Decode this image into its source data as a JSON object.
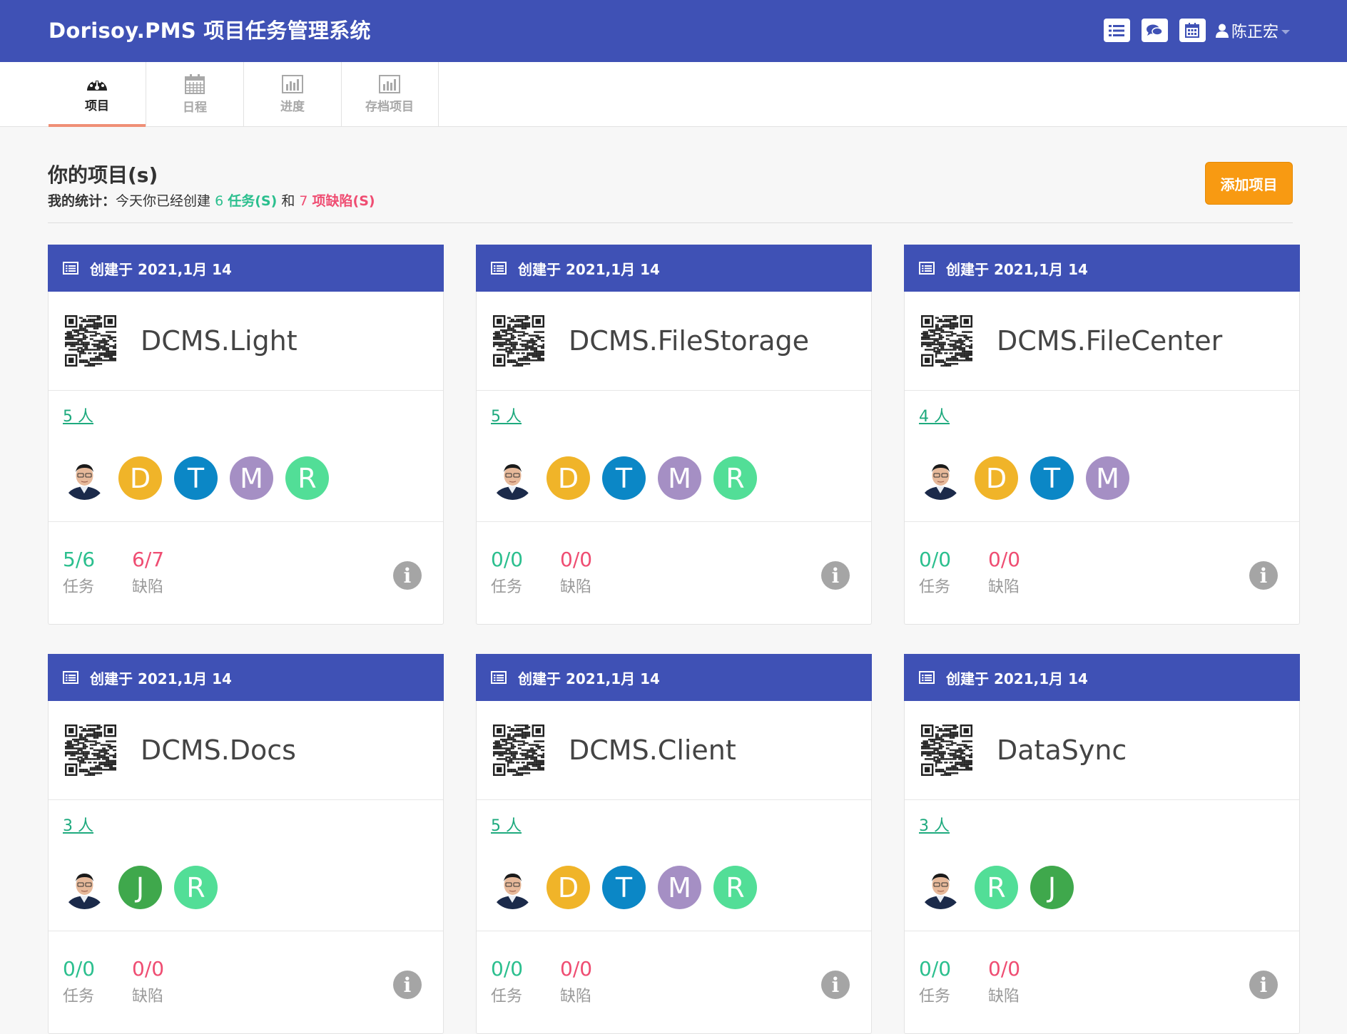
{
  "app": {
    "brand": "Dorisoy.PMS 项目任务管理系统",
    "top_icons": [
      "list-icon",
      "comments-icon",
      "calendar-icon"
    ],
    "user_name": "陈正宏"
  },
  "tabs": [
    {
      "label": "项目",
      "icon": "dashboard-icon",
      "active": true
    },
    {
      "label": "日程",
      "icon": "calendar-icon",
      "active": false
    },
    {
      "label": "进度",
      "icon": "bar-chart-icon",
      "active": false
    },
    {
      "label": "存档项目",
      "icon": "bar-chart-icon",
      "active": false
    }
  ],
  "heading": {
    "title": "你的项目(s)",
    "stats_label": "我的统计",
    "stats_colon": "：",
    "stats_text1": "今天你已经创建",
    "tasks_count": "6",
    "tasks_label": "任务(S)",
    "stats_and": "和",
    "defects_count": "7",
    "defects_label": "项缺陷(S)",
    "add_button": "添加项目"
  },
  "colors": {
    "primary": "#3f51b5",
    "accent_orange": "#f89a12",
    "task_green": "#2bbf8e",
    "defect_red": "#ef4d72"
  },
  "projects": [
    {
      "created": "创建于 2021,1月 14",
      "name": "DCMS.Light",
      "member_count": "5 人",
      "members": [
        {
          "type": "photo"
        },
        {
          "letter": "D",
          "color": "#f0b429"
        },
        {
          "letter": "T",
          "color": "#0b87c6"
        },
        {
          "letter": "M",
          "color": "#a58fc4"
        },
        {
          "letter": "R",
          "color": "#52de97"
        }
      ],
      "tasks": "5/6",
      "tasks_label": "任务",
      "defects": "6/7",
      "defects_label": "缺陷"
    },
    {
      "created": "创建于 2021,1月 14",
      "name": "DCMS.FileStorage",
      "member_count": "5 人",
      "members": [
        {
          "type": "photo"
        },
        {
          "letter": "D",
          "color": "#f0b429"
        },
        {
          "letter": "T",
          "color": "#0b87c6"
        },
        {
          "letter": "M",
          "color": "#a58fc4"
        },
        {
          "letter": "R",
          "color": "#52de97"
        }
      ],
      "tasks": "0/0",
      "tasks_label": "任务",
      "defects": "0/0",
      "defects_label": "缺陷"
    },
    {
      "created": "创建于 2021,1月 14",
      "name": "DCMS.FileCenter",
      "member_count": "4 人",
      "members": [
        {
          "type": "photo"
        },
        {
          "letter": "D",
          "color": "#f0b429"
        },
        {
          "letter": "T",
          "color": "#0b87c6"
        },
        {
          "letter": "M",
          "color": "#a58fc4"
        }
      ],
      "tasks": "0/0",
      "tasks_label": "任务",
      "defects": "0/0",
      "defects_label": "缺陷"
    },
    {
      "created": "创建于 2021,1月 14",
      "name": "DCMS.Docs",
      "member_count": "3 人",
      "members": [
        {
          "type": "photo"
        },
        {
          "letter": "J",
          "color": "#3fa84c"
        },
        {
          "letter": "R",
          "color": "#52de97"
        }
      ],
      "tasks": "0/0",
      "tasks_label": "任务",
      "defects": "0/0",
      "defects_label": "缺陷"
    },
    {
      "created": "创建于 2021,1月 14",
      "name": "DCMS.Client",
      "member_count": "5 人",
      "members": [
        {
          "type": "photo"
        },
        {
          "letter": "D",
          "color": "#f0b429"
        },
        {
          "letter": "T",
          "color": "#0b87c6"
        },
        {
          "letter": "M",
          "color": "#a58fc4"
        },
        {
          "letter": "R",
          "color": "#52de97"
        }
      ],
      "tasks": "0/0",
      "tasks_label": "任务",
      "defects": "0/0",
      "defects_label": "缺陷"
    },
    {
      "created": "创建于 2021,1月 14",
      "name": "DataSync",
      "member_count": "3 人",
      "members": [
        {
          "type": "photo"
        },
        {
          "letter": "R",
          "color": "#52de97"
        },
        {
          "letter": "J",
          "color": "#3fa84c"
        }
      ],
      "tasks": "0/0",
      "tasks_label": "任务",
      "defects": "0/0",
      "defects_label": "缺陷"
    }
  ]
}
